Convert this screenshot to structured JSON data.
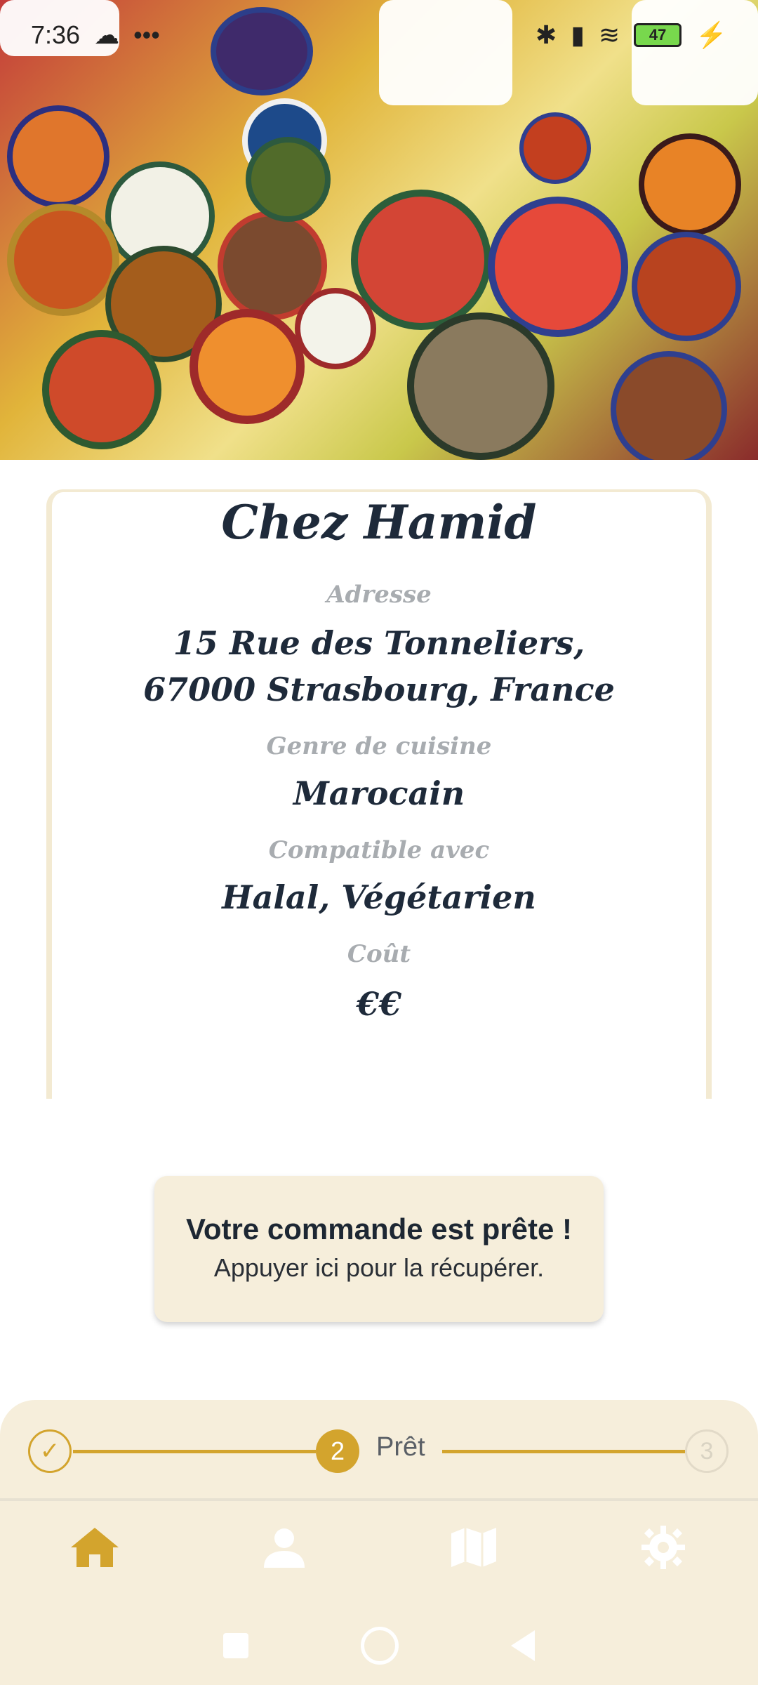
{
  "status": {
    "time": "7:36",
    "battery": "47"
  },
  "restaurant": {
    "name": "Chez Hamid",
    "address_label": "Adresse",
    "address_line1": "15 Rue des Tonneliers,",
    "address_line2": "67000 Strasbourg, France",
    "cuisine_label": "Genre de cuisine",
    "cuisine_value": "Marocain",
    "compat_label": "Compatible avec",
    "compat_value": "Halal, Végétarien",
    "cost_label": "Coût",
    "cost_value": "€€"
  },
  "order_ready": {
    "title": "Votre commande est prête !",
    "subtitle": "Appuyer ici pour la récupérer."
  },
  "stepper": {
    "step1_icon": "check-icon",
    "step2_number": "2",
    "step2_label": "Prêt",
    "step3_number": "3"
  },
  "nav": {
    "items": [
      "home-icon",
      "profile-icon",
      "map-icon",
      "settings-icon"
    ],
    "active_color": "#d3a42d",
    "inactive_color": "#ffffff"
  },
  "colors": {
    "accent": "#d3a42d",
    "card_bg": "#f6eedb",
    "text_dark": "#1e2a3a",
    "label_gray": "#a8acb0"
  }
}
